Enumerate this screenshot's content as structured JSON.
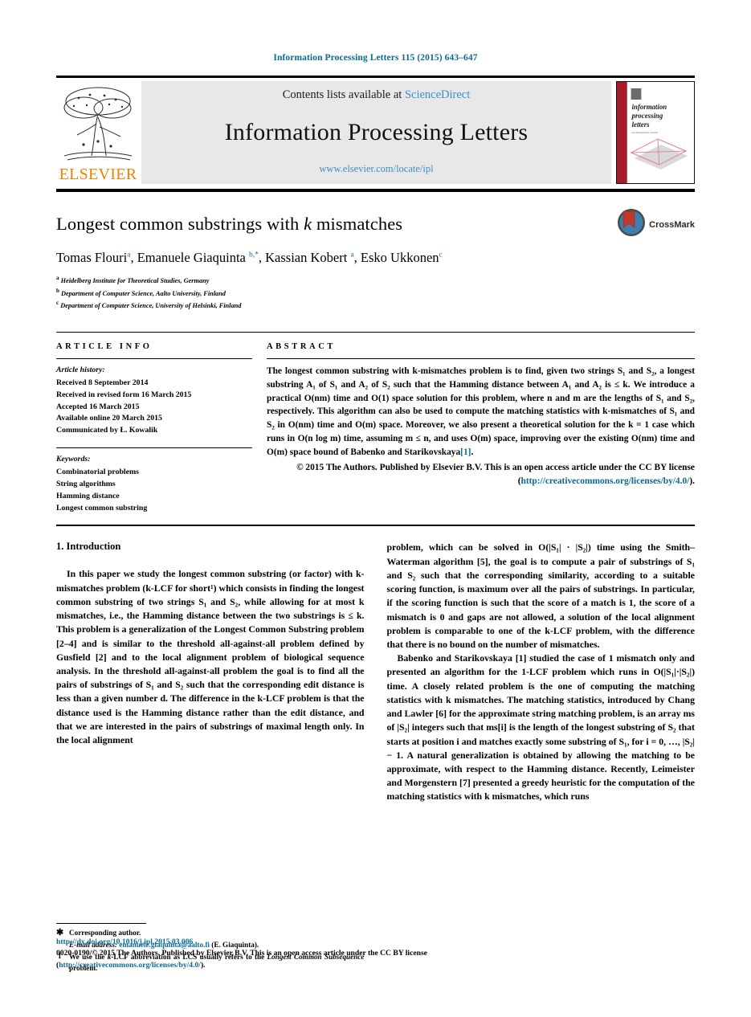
{
  "running_head": "Information Processing Letters 115 (2015) 643–647",
  "masthead": {
    "publisher_wordmark": "ELSEVIER",
    "contents_prefix": "Contents lists available at ",
    "contents_link": "ScienceDirect",
    "journal_title": "Information Processing Letters",
    "journal_url": "www.elsevier.com/locate/ipl",
    "cover_lines": [
      "information",
      "processing",
      "letters"
    ]
  },
  "article": {
    "title_pre": "Longest common substrings with ",
    "title_italic": "k",
    "title_post": " mismatches",
    "crossmark_label": "CrossMark",
    "authors": [
      {
        "name": "Tomas Flouri",
        "marks": "a"
      },
      {
        "name": "Emanuele Giaquinta",
        "marks": "b,*"
      },
      {
        "name": "Kassian Kobert",
        "marks": "a"
      },
      {
        "name": "Esko Ukkonen",
        "marks": "c"
      }
    ],
    "affiliations": [
      {
        "mark": "a",
        "text": "Heidelberg Institute for Theoretical Studies, Germany"
      },
      {
        "mark": "b",
        "text": "Department of Computer Science, Aalto University, Finland"
      },
      {
        "mark": "c",
        "text": "Department of Computer Science, University of Helsinki, Finland"
      }
    ]
  },
  "article_info": {
    "heading": "ARTICLE INFO",
    "history_label": "Article history:",
    "history": [
      "Received 8 September 2014",
      "Received in revised form 16 March 2015",
      "Accepted 16 March 2015",
      "Available online 20 March 2015",
      "Communicated by Ł. Kowalik"
    ],
    "keywords_label": "Keywords:",
    "keywords": [
      "Combinatorial problems",
      "String algorithms",
      "Hamming distance",
      "Longest common substring"
    ]
  },
  "abstract": {
    "heading": "ABSTRACT",
    "body": "The longest common substring with k-mismatches problem is to find, given two strings S₁ and S₂, a longest substring A₁ of S₁ and A₂ of S₂ such that the Hamming distance between A₁ and A₂ is ≤ k. We introduce a practical O(nm) time and O(1) space solution for this problem, where n and m are the lengths of S₁ and S₂, respectively. This algorithm can also be used to compute the matching statistics with k-mismatches of S₁ and S₂ in O(nm) time and O(m) space. Moreover, we also present a theoretical solution for the k = 1 case which runs in O(n log m) time, assuming m ≤ n, and uses O(m) space, improving over the existing O(nm) time and O(m) space bound of Babenko and Starikovskaya",
    "body_ref": "[1]",
    "body_tail": ".",
    "copyright": "© 2015 The Authors. Published by Elsevier B.V. This is an open access article under the CC BY license (",
    "copyright_link": "http://creativecommons.org/licenses/by/4.0/",
    "copyright_tail": ")."
  },
  "sections": {
    "intro_heading": "1. Introduction"
  },
  "body": {
    "left_p1": "In this paper we study the longest common substring (or factor) with k-mismatches problem (k-LCF for short¹) which consists in finding the longest common substring of two strings S₁ and S₂, while allowing for at most k mismatches, i.e., the Hamming distance between the two substrings is ≤ k. This problem is a generalization of the Longest Common Substring problem [2–4] and is similar to the threshold all-against-all problem defined by Gusfield [2] and to the local alignment problem of biological sequence analysis. In the threshold all-against-all problem the goal is to find all the pairs of substrings of S₁ and S₂ such that the corresponding edit distance is less than a given number d. The difference in the k-LCF problem is that the distance used is the Hamming distance rather than the edit distance, and that we are interested in the pairs of substrings of maximal length only. In the local alignment",
    "right_p1": "problem, which can be solved in O(|S₁| · |S₂|) time using the Smith–Waterman algorithm [5], the goal is to compute a pair of substrings of S₁ and S₂ such that the corresponding similarity, according to a suitable scoring function, is maximum over all the pairs of substrings. In particular, if the scoring function is such that the score of a match is 1, the score of a mismatch is 0 and gaps are not allowed, a solution of the local alignment problem is comparable to one of the k-LCF problem, with the difference that there is no bound on the number of mismatches.",
    "right_p2": "Babenko and Starikovskaya [1] studied the case of 1 mismatch only and presented an algorithm for the 1-LCF problem which runs in O(|S₁|·|S₂|) time. A closely related problem is the one of computing the matching statistics with k mismatches. The matching statistics, introduced by Chang and Lawler [6] for the approximate string matching problem, is an array ms of |S₂| integers such that ms[i] is the length of the longest substring of S₂ that starts at position i and matches exactly some substring of S₁, for i = 0, …, |S₂| − 1. A natural generalization is obtained by allowing the matching to be approximate, with respect to the Hamming distance. Recently, Leimeister and Morgenstern [7] presented a greedy heuristic for the computation of the matching statistics with k mismatches, which runs"
  },
  "footnotes": {
    "corresponding_marker": "✱",
    "corresponding_text": "Corresponding author.",
    "email_label": "E-mail address:",
    "email": "emanuele.giaquinta@aalto.fi",
    "email_owner": "(E. Giaquinta).",
    "note1_marker": "1",
    "note1_text_a": "We use the ",
    "note1_italic_a": "k",
    "note1_text_b": "-LCF abbreviation as LCS usually refers to the ",
    "note1_italic_b": "Longest Common Subsequence",
    "note1_text_c": " problem."
  },
  "page_footer": {
    "doi": "http://dx.doi.org/10.1016/j.ipl.2015.03.006",
    "copyright_line": "0020-0190/© 2015 The Authors. Published by Elsevier B.V. This is an open access article under the CC BY license",
    "license_open": "(",
    "license_link": "http://creativecommons.org/licenses/by/4.0/",
    "license_close": ")."
  },
  "colors": {
    "link": "#0b6a93",
    "science_direct": "#3d8fc9",
    "elsevier_orange": "#ef8200",
    "cover_red": "#a61c2b",
    "masthead_grey": "#e8e8e8"
  }
}
